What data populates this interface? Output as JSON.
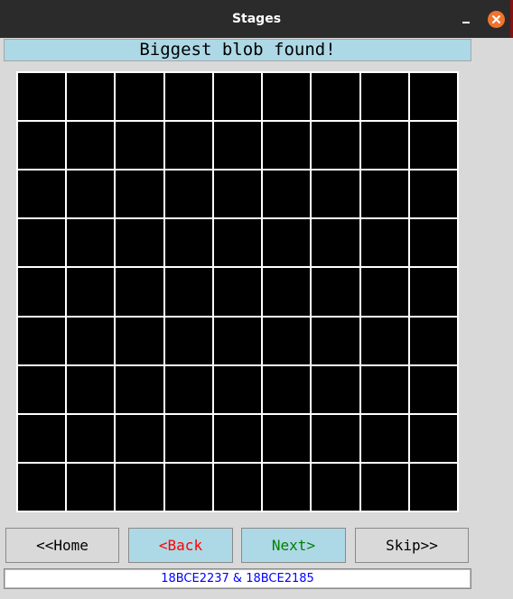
{
  "window": {
    "title": "Stages"
  },
  "header": {
    "message": "Biggest blob found!"
  },
  "grid": {
    "rows": 9,
    "cols": 9,
    "cell_color": "#000000",
    "line_color": "#ffffff"
  },
  "buttons": {
    "home_label": "<<Home",
    "back_label": "<Back",
    "next_label": "Next>",
    "skip_label": "Skip>>"
  },
  "footer": {
    "credits": "18BCE2237 & 18BCE2185"
  },
  "colors": {
    "titlebar": "#2b2b2b",
    "header_bg": "#add8e6",
    "back_text": "#ff0000",
    "next_text": "#008000",
    "footer_text": "#0000ff",
    "close_button": "#f0742c"
  }
}
